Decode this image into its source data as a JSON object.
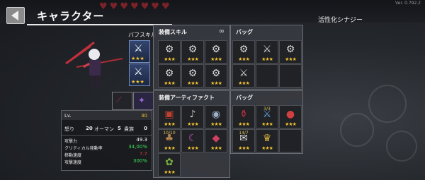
{
  "header": {
    "title": "キャラクター",
    "synergy_label": "活性化シナジー",
    "version": "Ver. 0.792.2",
    "hearts": 7
  },
  "buff": {
    "label": "バフスキル"
  },
  "skills_panel": {
    "title": "装備スキル",
    "stars": [
      "★★★",
      "★★★",
      "★★★",
      "★★★",
      "★★★",
      "★★★"
    ]
  },
  "bag_top": {
    "title": "バッグ",
    "stars": [
      "★★★",
      "★★★",
      "★★★",
      "★★★"
    ]
  },
  "artifacts_panel": {
    "title": "装備アーティファクト",
    "counts": [
      "",
      "",
      "",
      "10/10",
      "",
      ""
    ],
    "stars": [
      "★★★",
      "★★★",
      "★★★",
      "★★★",
      "★★★",
      "★★★",
      "★★★"
    ]
  },
  "bag_bottom": {
    "title": "バッグ",
    "counts": [
      "",
      "3/3",
      "",
      "14/7",
      "",
      ""
    ],
    "stars": [
      "★★★",
      "★★★",
      "★★★",
      "★★★",
      "★★★"
    ]
  },
  "stats": {
    "lv_label": "Lv.",
    "lv_value": "30",
    "anger_label": "怒り",
    "anger_value": "20",
    "auman_label": "オーマン",
    "auman_value": "5",
    "noble_label": "貴族",
    "noble_value": "0",
    "rows": [
      {
        "label": "攻撃力",
        "value": "49.3",
        "color": "#ffffff"
      },
      {
        "label": "クリティカル発動率",
        "value": "34,00%",
        "color": "#3ee05a"
      },
      {
        "label": "移動速度",
        "value": "7.7",
        "color": "#e03c3c"
      },
      {
        "label": "攻撃速度",
        "value": "300%",
        "color": "#3ee05a"
      }
    ]
  }
}
